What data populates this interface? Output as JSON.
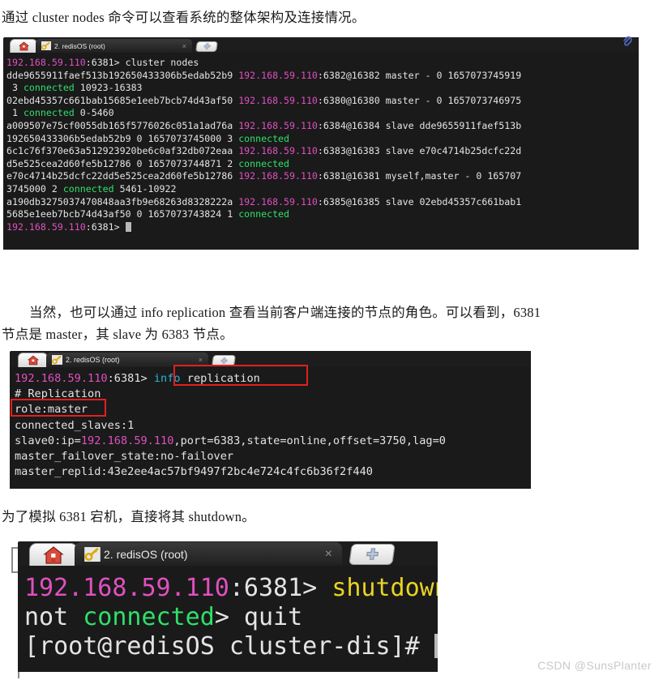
{
  "paragraphs": {
    "p1": "通过 cluster nodes 命令可以查看系统的整体架构及连接情况。",
    "p2_line1": "当然，也可以通过 info replication 查看当前客户端连接的节点的角色。可以看到，6381",
    "p2_line2": "节点是 master，其 slave 为 6383 节点。",
    "p3": "为了模拟 6381 宕机，直接将其 shutdown。"
  },
  "tabs": {
    "title": "2. redisOS (root)",
    "close_label": "×",
    "new_tab_label": "✚",
    "home_icon": "home-icon",
    "key_icon": "key-icon",
    "paperclip_icon": "paperclip-icon"
  },
  "terminal1": {
    "lines": [
      [
        {
          "t": "192.168.59.110",
          "c": "c-prompt"
        },
        {
          "t": ":6381> cluster nodes",
          "c": "c-white"
        }
      ],
      [
        {
          "t": "dde9655911faef513b192650433306b5edab52b9 ",
          "c": "c-white"
        },
        {
          "t": "192.168.59.110",
          "c": "c-prompt"
        },
        {
          "t": ":6382@16382 master - 0 1657073745919",
          "c": "c-white"
        }
      ],
      [
        {
          "t": " 3 ",
          "c": "c-white"
        },
        {
          "t": "connected",
          "c": "c-green"
        },
        {
          "t": " 10923-16383",
          "c": "c-white"
        }
      ],
      [
        {
          "t": "02ebd45357c661bab15685e1eeb7bcb74d43af50 ",
          "c": "c-white"
        },
        {
          "t": "192.168.59.110",
          "c": "c-prompt"
        },
        {
          "t": ":6380@16380 master - 0 1657073746975",
          "c": "c-white"
        }
      ],
      [
        {
          "t": " 1 ",
          "c": "c-white"
        },
        {
          "t": "connected",
          "c": "c-green"
        },
        {
          "t": " 0-5460",
          "c": "c-white"
        }
      ],
      [
        {
          "t": "a009507e75cf0055db165f5776026c051a1ad76a ",
          "c": "c-white"
        },
        {
          "t": "192.168.59.110",
          "c": "c-prompt"
        },
        {
          "t": ":6384@16384 slave dde9655911faef513b",
          "c": "c-white"
        }
      ],
      [
        {
          "t": "192650433306b5edab52b9 0 1657073745000 3 ",
          "c": "c-white"
        },
        {
          "t": "connected",
          "c": "c-green"
        }
      ],
      [
        {
          "t": "6c1c76f370e63a512923920be6c0af32db072eaa ",
          "c": "c-white"
        },
        {
          "t": "192.168.59.110",
          "c": "c-prompt"
        },
        {
          "t": ":6383@16383 slave e70c4714b25dcfc22d",
          "c": "c-white"
        }
      ],
      [
        {
          "t": "d5e525cea2d60fe5b12786 0 1657073744871 2 ",
          "c": "c-white"
        },
        {
          "t": "connected",
          "c": "c-green"
        }
      ],
      [
        {
          "t": "e70c4714b25dcfc22dd5e525cea2d60fe5b12786 ",
          "c": "c-white"
        },
        {
          "t": "192.168.59.110",
          "c": "c-prompt"
        },
        {
          "t": ":6381@16381 myself,master - 0 165707",
          "c": "c-white"
        }
      ],
      [
        {
          "t": "3745000 2 ",
          "c": "c-white"
        },
        {
          "t": "connected",
          "c": "c-green"
        },
        {
          "t": " 5461-10922",
          "c": "c-white"
        }
      ],
      [
        {
          "t": "a190db3275037470848aa3fb9e68263d8328222a ",
          "c": "c-white"
        },
        {
          "t": "192.168.59.110",
          "c": "c-prompt"
        },
        {
          "t": ":6385@16385 slave 02ebd45357c661bab1",
          "c": "c-white"
        }
      ],
      [
        {
          "t": "5685e1eeb7bcb74d43af50 0 1657073743824 1 ",
          "c": "c-white"
        },
        {
          "t": "connected",
          "c": "c-green"
        }
      ],
      [
        {
          "t": "192.168.59.110",
          "c": "c-prompt"
        },
        {
          "t": ":6381> ",
          "c": "c-white"
        },
        {
          "t": "",
          "c": "cursor"
        }
      ]
    ]
  },
  "terminal2": {
    "lines": [
      [
        {
          "t": "192.168.59.110",
          "c": "c-prompt"
        },
        {
          "t": ":6381> ",
          "c": "c-white"
        },
        {
          "t": "info",
          "c": "c-cyan"
        },
        {
          "t": " replication",
          "c": "c-white"
        }
      ],
      [
        {
          "t": "# Replication",
          "c": "c-white"
        }
      ],
      [
        {
          "t": "role:master",
          "c": "c-white"
        }
      ],
      [
        {
          "t": "connected_slaves:1",
          "c": "c-white"
        }
      ],
      [
        {
          "t": "slave0:ip=",
          "c": "c-white"
        },
        {
          "t": "192.168.59.110",
          "c": "c-prompt"
        },
        {
          "t": ",port=6383,state=online,offset=3750,lag=0",
          "c": "c-white"
        }
      ],
      [
        {
          "t": "master_failover_state:no-failover",
          "c": "c-white"
        }
      ],
      [
        {
          "t": "master_replid:43e2ee4ac57bf9497f2bc4e724c4fc6b36f2f440",
          "c": "c-white"
        }
      ]
    ],
    "annotations": [
      {
        "name": "info-replication-highlight"
      },
      {
        "name": "role-master-highlight"
      }
    ]
  },
  "terminal3": {
    "lines": [
      [
        {
          "t": "192.168.59.110",
          "c": "c-prompt"
        },
        {
          "t": ":6381> ",
          "c": "c-white"
        },
        {
          "t": "shutdown",
          "c": "c-yellow"
        }
      ],
      [
        {
          "t": "not ",
          "c": "c-white"
        },
        {
          "t": "connected",
          "c": "c-green"
        },
        {
          "t": "> quit",
          "c": "c-white"
        }
      ],
      [
        {
          "t": "[root@redisOS cluster-dis]# ",
          "c": "c-white"
        },
        {
          "t": "",
          "c": "cursor"
        }
      ]
    ]
  },
  "watermark": "CSDN @SunsPlanter"
}
